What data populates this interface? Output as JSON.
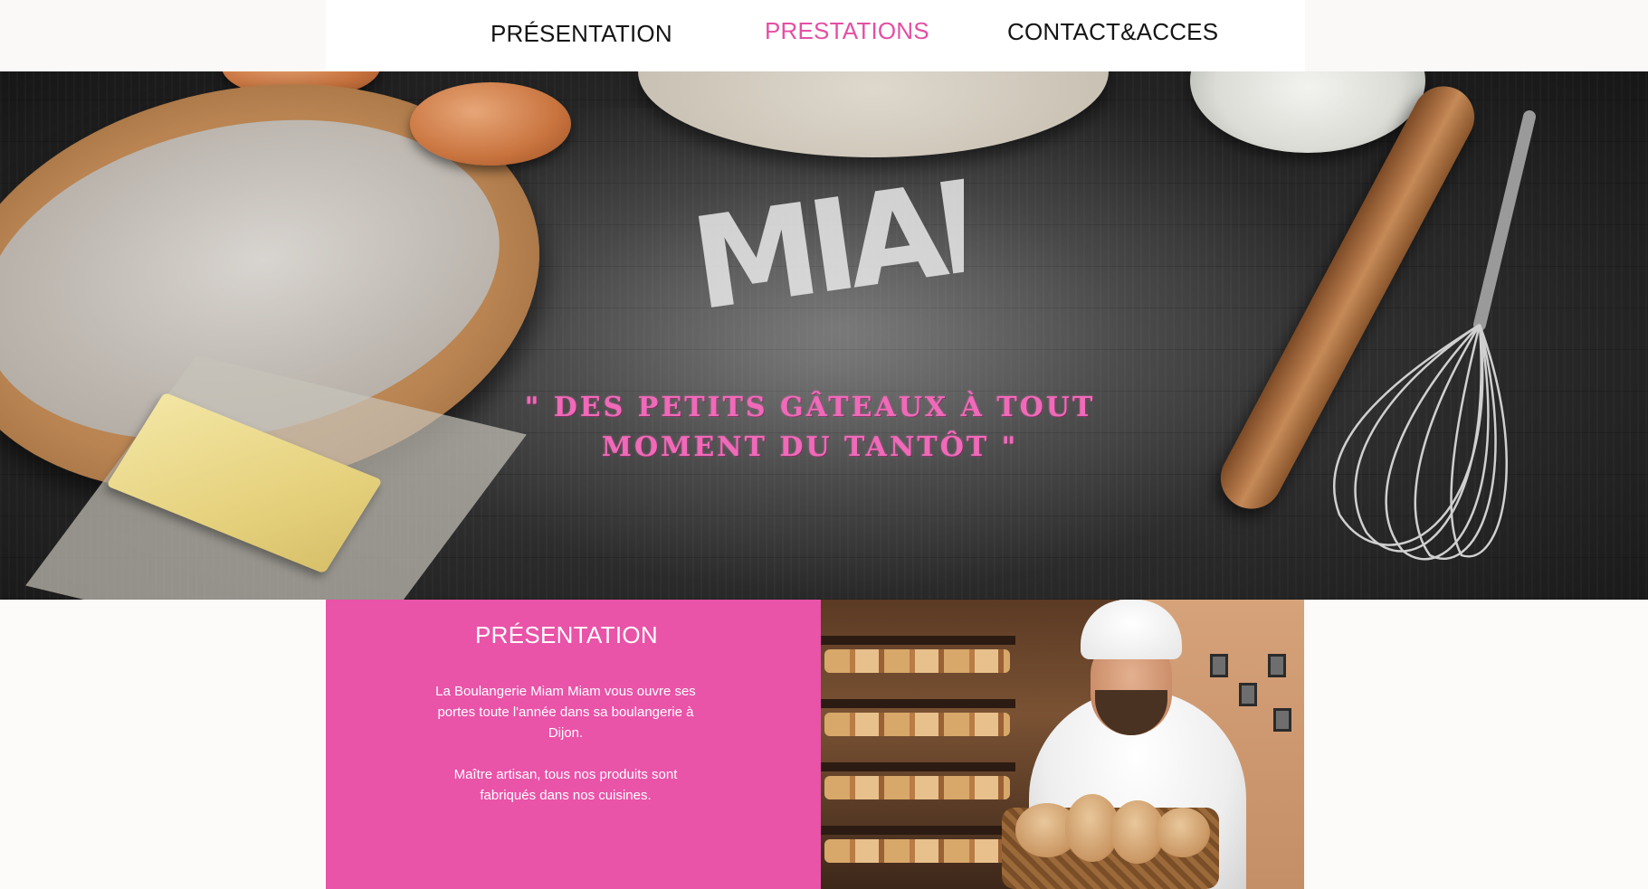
{
  "nav": {
    "items": [
      {
        "label": "PRÉSENTATION",
        "active": false
      },
      {
        "label": "PRESTATIONS",
        "active": true
      },
      {
        "label": "CONTACT&ACCES",
        "active": false
      }
    ],
    "active_color": "#e44fa4",
    "text_color": "#141414"
  },
  "hero": {
    "logo_text": "MIAM!",
    "tagline_line1": "\" DES PETITS GÂTEAUX À TOUT",
    "tagline_line2": "MOMENT DU TANTÔT \""
  },
  "presentation": {
    "title": "PRÉSENTATION",
    "paragraph1": "La Boulangerie Miam Miam vous ouvre ses portes toute l'année dans sa boulangerie à Dijon.",
    "paragraph2": "Maître artisan, tous nos produits sont fabriqués dans nos cuisines.",
    "panel_color": "#e953a8"
  },
  "photo": {
    "icon": "chef-bakery-photo"
  }
}
